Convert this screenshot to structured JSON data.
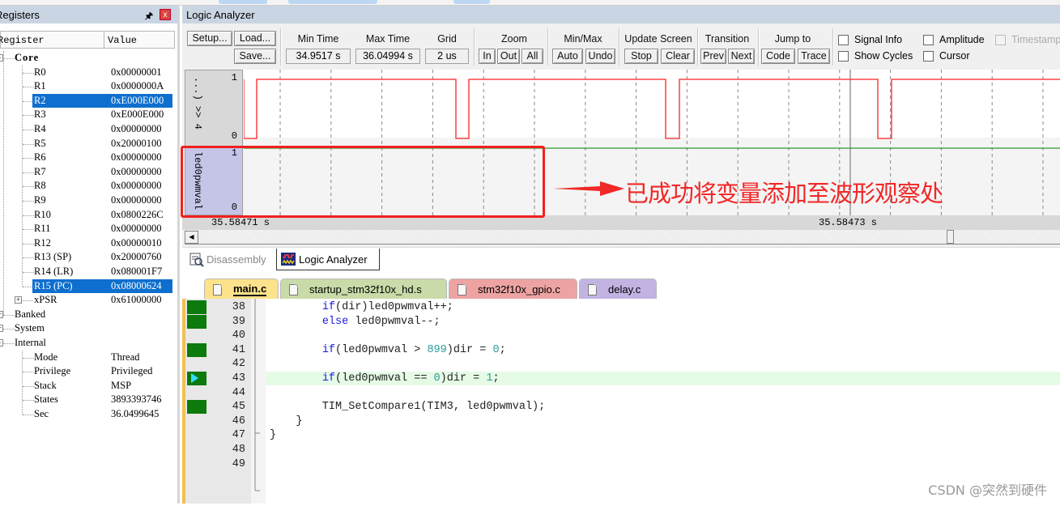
{
  "registers": {
    "title": "Registers",
    "columns": [
      "Register",
      "Value"
    ],
    "groups": {
      "core": "Core",
      "banked": "Banked",
      "system": "System",
      "internal": "Internal"
    },
    "core_rows": [
      {
        "name": "R0",
        "value": "0x00000001",
        "selected": false
      },
      {
        "name": "R1",
        "value": "0x0000000A",
        "selected": false
      },
      {
        "name": "R2",
        "value": "0xE000E000",
        "selected": true
      },
      {
        "name": "R3",
        "value": "0xE000E000",
        "selected": false
      },
      {
        "name": "R4",
        "value": "0x00000000",
        "selected": false
      },
      {
        "name": "R5",
        "value": "0x20000100",
        "selected": false
      },
      {
        "name": "R6",
        "value": "0x00000000",
        "selected": false
      },
      {
        "name": "R7",
        "value": "0x00000000",
        "selected": false
      },
      {
        "name": "R8",
        "value": "0x00000000",
        "selected": false
      },
      {
        "name": "R9",
        "value": "0x00000000",
        "selected": false
      },
      {
        "name": "R10",
        "value": "0x0800226C",
        "selected": false
      },
      {
        "name": "R11",
        "value": "0x00000000",
        "selected": false
      },
      {
        "name": "R12",
        "value": "0x00000010",
        "selected": false
      },
      {
        "name": "R13 (SP)",
        "value": "0x20000760",
        "selected": false
      },
      {
        "name": "R14 (LR)",
        "value": "0x080001F7",
        "selected": false
      },
      {
        "name": "R15 (PC)",
        "value": "0x08000624",
        "selected": true
      },
      {
        "name": "xPSR",
        "value": "0x61000000",
        "selected": false
      }
    ],
    "internal_rows": [
      {
        "name": "Mode",
        "value": "Thread"
      },
      {
        "name": "Privilege",
        "value": "Privileged"
      },
      {
        "name": "Stack",
        "value": "MSP"
      },
      {
        "name": "States",
        "value": "3893393746"
      },
      {
        "name": "Sec",
        "value": "36.0499645"
      }
    ]
  },
  "logic_analyzer": {
    "title": "Logic Analyzer",
    "buttons": {
      "setup": "Setup...",
      "load": "Load...",
      "save": "Save...",
      "zoom_in": "In",
      "zoom_out": "Out",
      "zoom_all": "All",
      "auto": "Auto",
      "undo": "Undo",
      "stop": "Stop",
      "clear": "Clear",
      "prev": "Prev",
      "next": "Next",
      "code": "Code",
      "trace": "Trace"
    },
    "labels": {
      "min_time": "Min Time",
      "max_time": "Max Time",
      "grid": "Grid",
      "zoom": "Zoom",
      "minmax": "Min/Max",
      "update_screen": "Update Screen",
      "transition": "Transition",
      "jump_to": "Jump to"
    },
    "values": {
      "min_time": "34.9517 s",
      "max_time": "36.04994 s",
      "grid": "2 us"
    },
    "checkboxes": [
      {
        "label": "Signal Info",
        "checked": false,
        "enabled": true
      },
      {
        "label": "Amplitude",
        "checked": false,
        "enabled": true
      },
      {
        "label": "Timestamps",
        "checked": false,
        "enabled": false
      },
      {
        "label": "Show Cycles",
        "checked": false,
        "enabled": true
      },
      {
        "label": "Cursor",
        "checked": false,
        "enabled": true
      }
    ],
    "signals": [
      {
        "name": "...) >> 4",
        "high_label": "1",
        "low_label": "0",
        "color": "#ff2020"
      },
      {
        "name": "led0pwmval",
        "high_label": "1",
        "low_label": "0",
        "color": "#2a9a2a"
      }
    ],
    "time_left": "35.58471 s",
    "time_cursor": "35.58473 s"
  },
  "annotation": {
    "text": "已成功将变量添加至波形观察处",
    "color": "#f02828"
  },
  "view_tabs": [
    {
      "label": "Disassembly",
      "active": false
    },
    {
      "label": "Logic Analyzer",
      "active": true
    }
  ],
  "file_tabs": [
    {
      "label": "main.c",
      "active": true,
      "color": "#fde28c"
    },
    {
      "label": "startup_stm32f10x_hd.s",
      "active": false,
      "color": "#c9dba8"
    },
    {
      "label": "stm32f10x_gpio.c",
      "active": false,
      "color": "#eea3a3"
    },
    {
      "label": "delay.c",
      "active": false,
      "color": "#c2b3e3"
    }
  ],
  "code_lines": [
    {
      "num": "38",
      "text": "        if(dir)led0pwmval++;",
      "mark": true
    },
    {
      "num": "39",
      "text": "        else led0pwmval--;",
      "mark": true
    },
    {
      "num": "40",
      "text": "",
      "mark": false
    },
    {
      "num": "41",
      "text": "        if(led0pwmval > 899)dir = 0;",
      "mark": true
    },
    {
      "num": "42",
      "text": "",
      "mark": false
    },
    {
      "num": "43",
      "text": "        if(led0pwmval == 0)dir = 1;",
      "mark": true,
      "current": true
    },
    {
      "num": "44",
      "text": "",
      "mark": false
    },
    {
      "num": "45",
      "text": "        TIM_SetCompare1(TIM3, led0pwmval);",
      "mark": true
    },
    {
      "num": "46",
      "text": "    }",
      "mark": false
    },
    {
      "num": "47",
      "text": "}",
      "mark": false
    },
    {
      "num": "48",
      "text": "",
      "mark": false
    },
    {
      "num": "49",
      "text": "",
      "mark": false
    }
  ],
  "watermark": "CSDN @突然到硬件"
}
